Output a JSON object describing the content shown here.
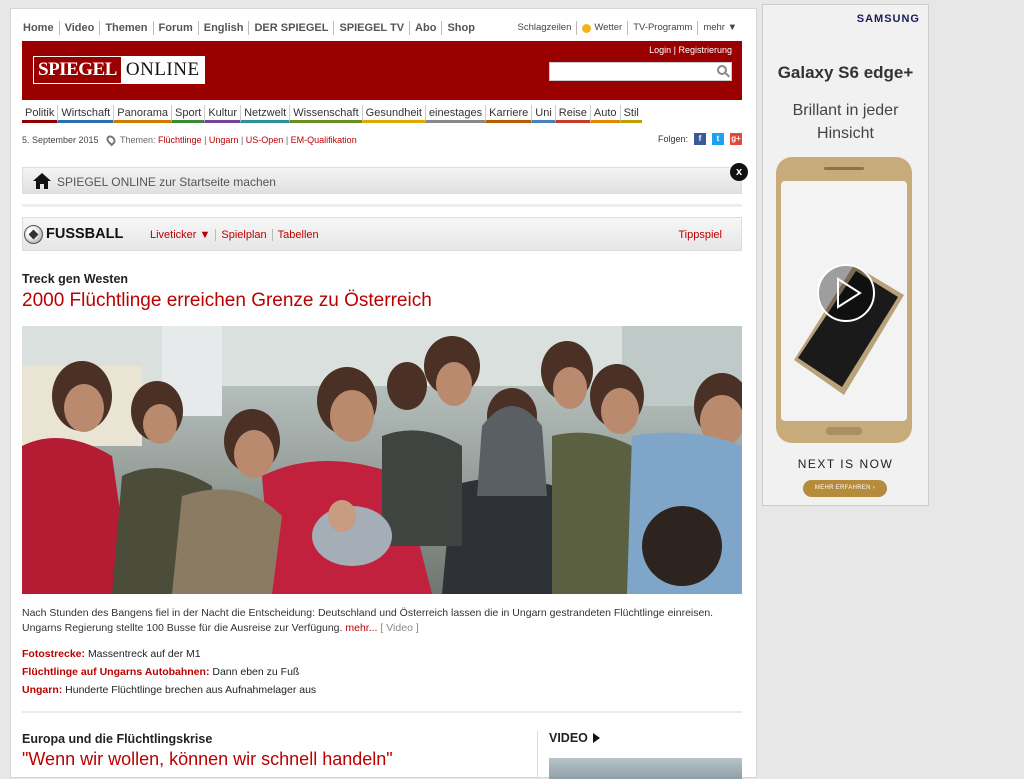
{
  "topnav": {
    "left": [
      "Home",
      "Video",
      "Themen",
      "Forum",
      "English",
      "DER SPIEGEL",
      "SPIEGEL TV",
      "Abo",
      "Shop"
    ],
    "right": {
      "schlagzeilen": "Schlagzeilen",
      "wetter": "Wetter",
      "tv": "TV-Programm",
      "mehr": "mehr ▼"
    }
  },
  "header": {
    "logo_a": "SPIEGEL",
    "logo_b": "ONLINE",
    "login": "Login",
    "register": "Registrierung",
    "search_placeholder": ""
  },
  "catnav": [
    {
      "label": "Politik",
      "color": "#8b0000"
    },
    {
      "label": "Wirtschaft",
      "color": "#2a6fb0"
    },
    {
      "label": "Panorama",
      "color": "#d07a00"
    },
    {
      "label": "Sport",
      "color": "#3a8a3a"
    },
    {
      "label": "Kultur",
      "color": "#7a3f96"
    },
    {
      "label": "Netzwelt",
      "color": "#2d8fa0"
    },
    {
      "label": "Wissenschaft",
      "color": "#6b8e23"
    },
    {
      "label": "Gesundheit",
      "color": "#e0a800"
    },
    {
      "label": "einestages",
      "color": "#888888"
    },
    {
      "label": "Karriere",
      "color": "#b45f06"
    },
    {
      "label": "Uni",
      "color": "#4a7fc0"
    },
    {
      "label": "Reise",
      "color": "#c43c2a"
    },
    {
      "label": "Auto",
      "color": "#e48800"
    },
    {
      "label": "Stil",
      "color": "#c0a000"
    }
  ],
  "dateline": {
    "date": "5. September 2015",
    "themes_label": "Themen:",
    "themes": [
      "Flüchtlinge",
      "Ungarn",
      "US-Open",
      "EM-Qualifikation"
    ],
    "follow": "Folgen:",
    "social": [
      "f",
      "t",
      "g+"
    ]
  },
  "startbar": {
    "text": "SPIEGEL ONLINE zur Startseite machen",
    "close": "x"
  },
  "fussball": {
    "title": "FUSSBALL",
    "links": [
      "Liveticker ▼",
      "Spielplan",
      "Tabellen"
    ],
    "tippspiel": "Tippspiel"
  },
  "lead": {
    "kicker": "Treck gen Westen",
    "headline": "2000 Flüchtlinge erreichen Grenze zu Österreich",
    "teaser": "Nach Stunden des Bangens fiel in der Nacht die Entscheidung: Deutschland und Österreich lassen die in Ungarn gestrandeten Flüchtlinge einreisen. Ungarns Regierung stellte 100 Busse für die Ausreise zur Verfügung.",
    "more": "mehr...",
    "video": "[ Video ]",
    "related": [
      {
        "kicker": "Fotostrecke:",
        "text": "Massentreck auf der M1"
      },
      {
        "kicker": "Flüchtlinge auf Ungarns Autobahnen:",
        "text": "Dann eben zu Fuß"
      },
      {
        "kicker": "Ungarn:",
        "text": "Hunderte Flüchtlinge brechen aus Aufnahmelager aus"
      }
    ]
  },
  "second": {
    "kicker": "Europa und die Flüchtlingskrise",
    "headline": "\"Wenn wir wollen, können wir schnell handeln\""
  },
  "video_box": {
    "title": "VIDEO"
  },
  "ad": {
    "brand": "SAMSUNG",
    "model": "Galaxy S6 edge+",
    "tagline_1": "Brillant in jeder",
    "tagline_2": "Hinsicht",
    "next": "NEXT IS NOW",
    "cta": "MEHR ERFAHREN ›"
  }
}
